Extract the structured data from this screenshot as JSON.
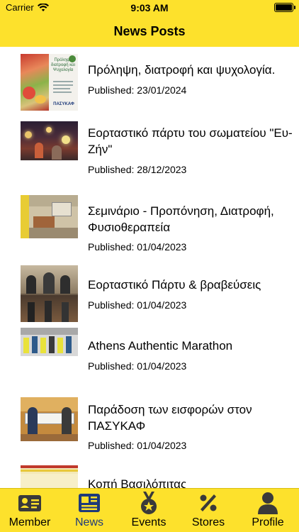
{
  "status_bar": {
    "carrier": "Carrier",
    "time": "9:03 AM"
  },
  "header": {
    "title": "News Posts"
  },
  "posts": [
    {
      "title": "Πρόληψη, διατροφή και ψυχολογία.",
      "date": "Published: 23/01/2024"
    },
    {
      "title": "Εορταστικό πάρτυ του σωματείου \"Ευ-Ζήν\"",
      "date": "Published: 28/12/2023"
    },
    {
      "title": "Σεμινάριο - Προπόνηση, Διατροφή, Φυσιοθεραπεία",
      "date": "Published: 01/04/2023"
    },
    {
      "title": "Εορταστικό Πάρτυ & βραβεύσεις",
      "date": "Published: 01/04/2023"
    },
    {
      "title": "Athens Authentic Marathon",
      "date": "Published: 01/04/2023"
    },
    {
      "title": "Παράδοση των εισφορών στον ΠΑΣΥΚΑΦ",
      "date": "Published: 01/04/2023"
    },
    {
      "title": "Κοπή Βασιλόπιτας",
      "date": ""
    }
  ],
  "thumb_text": {
    "poster_title": "Πρόληψη διατροφή και Ψυχολογία",
    "poster_footer": "ΠΑΣΥΚΑΦ"
  },
  "tabs": [
    {
      "label": "Member",
      "icon": "member-card-icon"
    },
    {
      "label": "News",
      "icon": "newspaper-icon"
    },
    {
      "label": "Events",
      "icon": "medal-icon"
    },
    {
      "label": "Stores",
      "icon": "percent-icon"
    },
    {
      "label": "Profile",
      "icon": "person-icon"
    }
  ],
  "active_tab": "News",
  "colors": {
    "accent": "#fde12c",
    "active_tab": "#1e3a7a",
    "icon": "#3a3a3a"
  }
}
